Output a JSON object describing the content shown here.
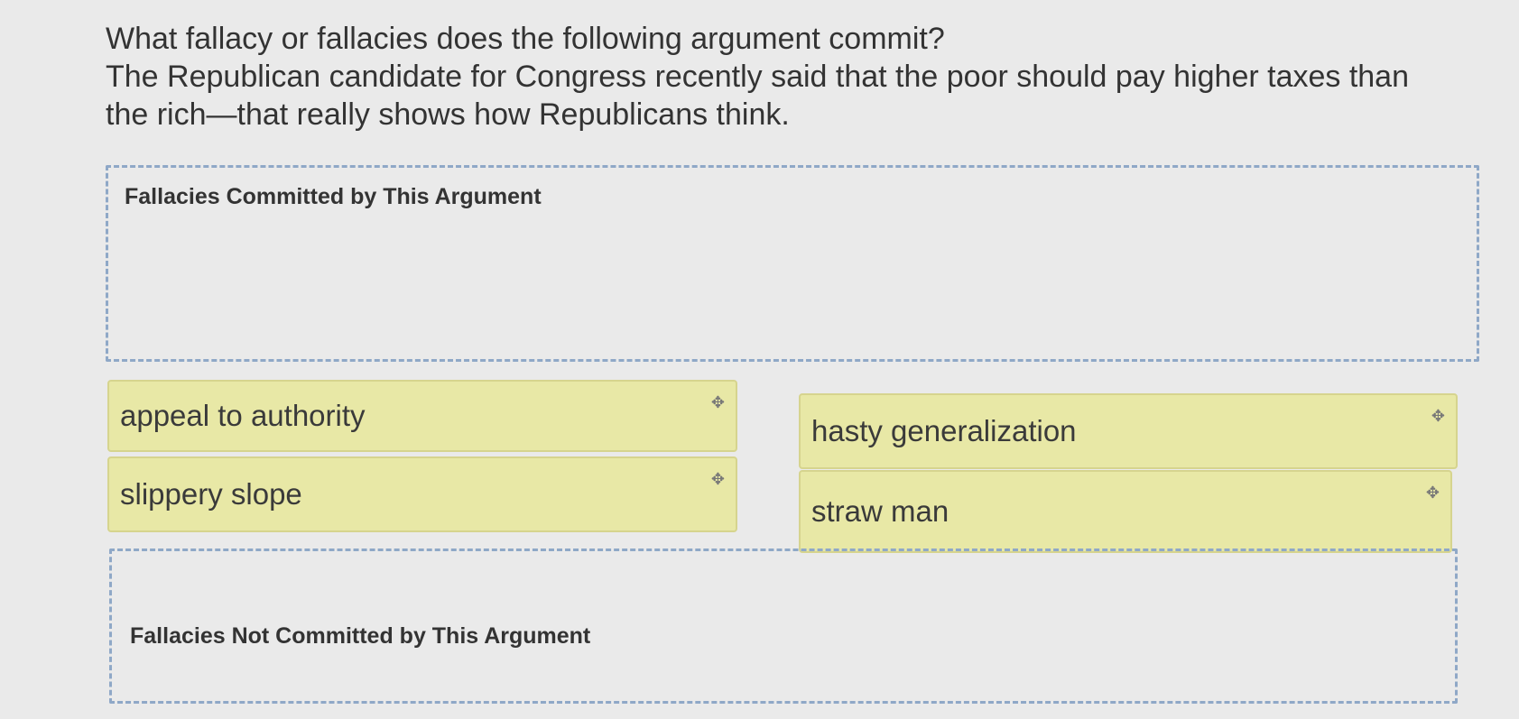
{
  "question": {
    "prompt": "What fallacy or fallacies does the following argument commit?",
    "argument": "The Republican candidate for Congress recently said that the poor should pay higher taxes than the rich—that really shows how Republicans think."
  },
  "zones": {
    "committed_label": "Fallacies Committed by This Argument",
    "not_committed_label": "Fallacies Not Committed by This Argument"
  },
  "chips": [
    {
      "label": "appeal to authority",
      "icon": "move-icon"
    },
    {
      "label": "hasty generalization",
      "icon": "move-icon"
    },
    {
      "label": "slippery slope",
      "icon": "move-icon"
    },
    {
      "label": "straw man",
      "icon": "move-icon"
    }
  ],
  "colors": {
    "chip_background": "#e8e8a6",
    "zone_border": "#8fa8c7"
  }
}
